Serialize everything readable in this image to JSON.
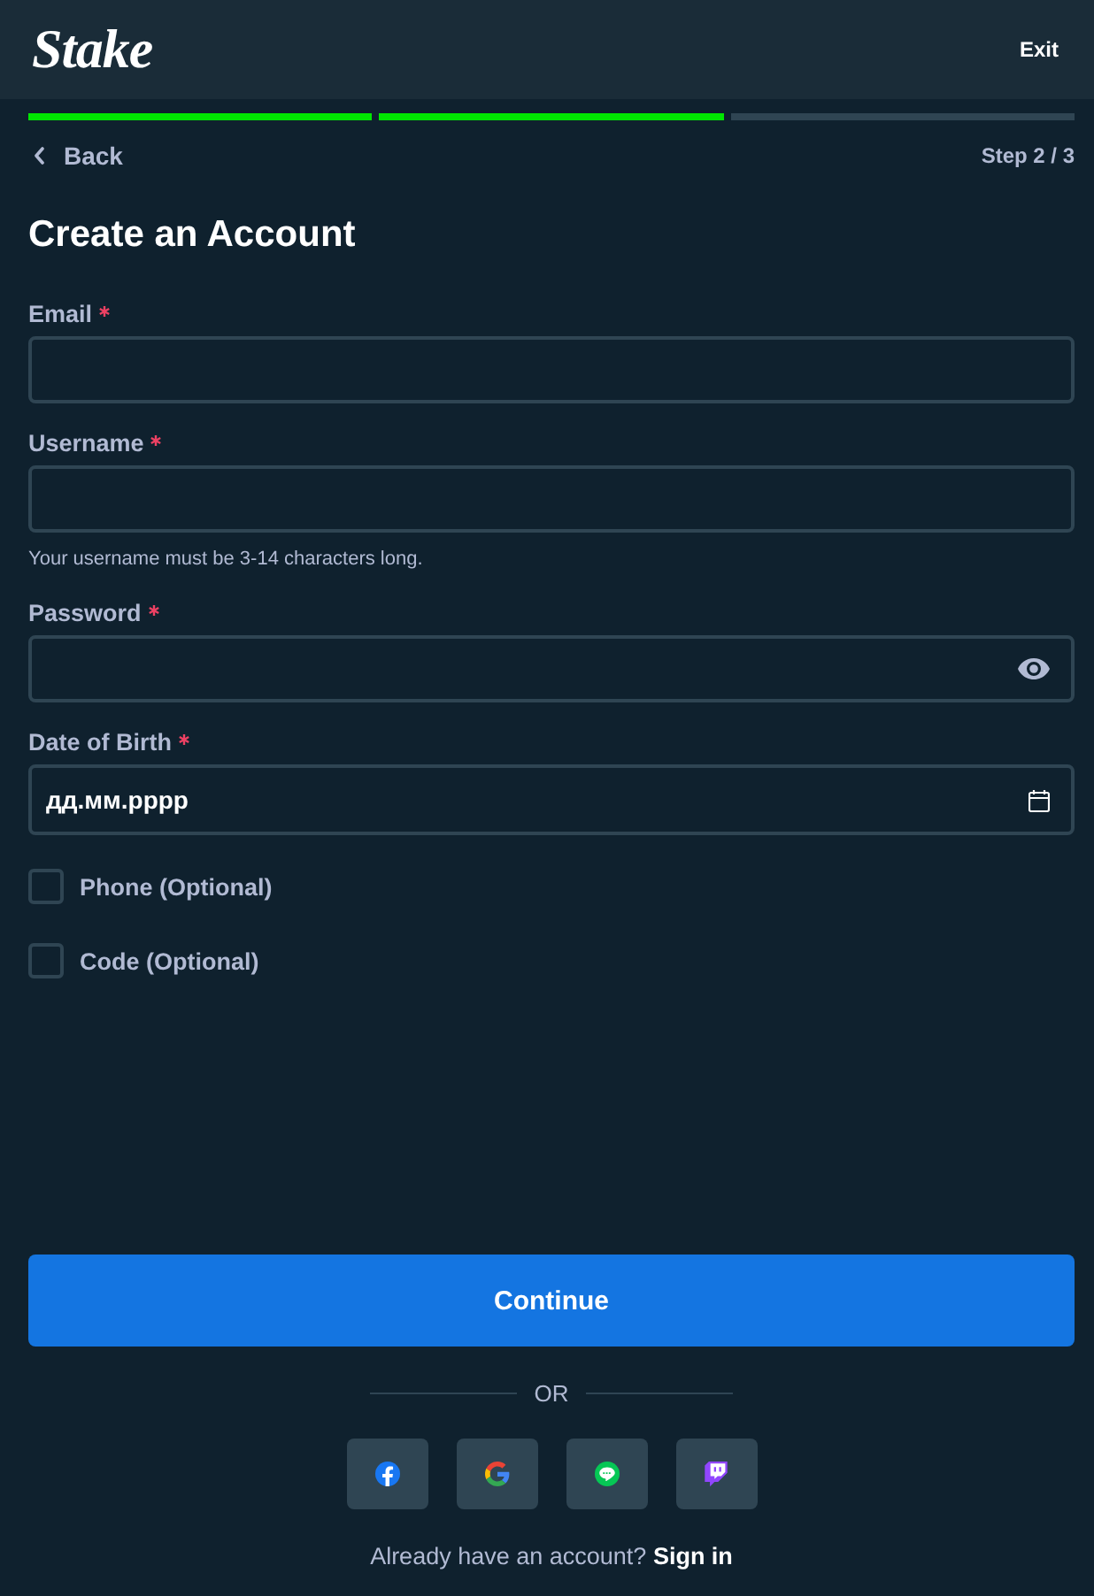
{
  "header": {
    "logo": "Stake",
    "exit_button": "Exit"
  },
  "progress": {
    "steps": [
      {
        "completed": true
      },
      {
        "completed": true
      },
      {
        "completed": false
      }
    ]
  },
  "nav": {
    "back": "Back",
    "step": "Step 2 / 3"
  },
  "title": "Create an Account",
  "fields": [
    {
      "kind": "text",
      "label": "Email",
      "required": true
    },
    {
      "kind": "text",
      "label": "Username",
      "required": true,
      "hint": "Your username must be 3-14 characters long."
    },
    {
      "kind": "password",
      "label": "Password",
      "required": true
    },
    {
      "kind": "date",
      "label": "Date of Birth",
      "required": true,
      "value": "дд.мм.рррр"
    }
  ],
  "options": [
    {
      "label": "Phone (Optional)",
      "checked": false
    },
    {
      "label": "Code (Optional)",
      "checked": false
    }
  ],
  "continue_button": "Continue",
  "divider": "OR",
  "social_buttons": [
    {
      "kind": "facebook"
    },
    {
      "kind": "google"
    },
    {
      "kind": "line"
    },
    {
      "kind": "twitch"
    }
  ],
  "sign_in": {
    "prompt": "Already have an account?",
    "link": "Sign in"
  }
}
